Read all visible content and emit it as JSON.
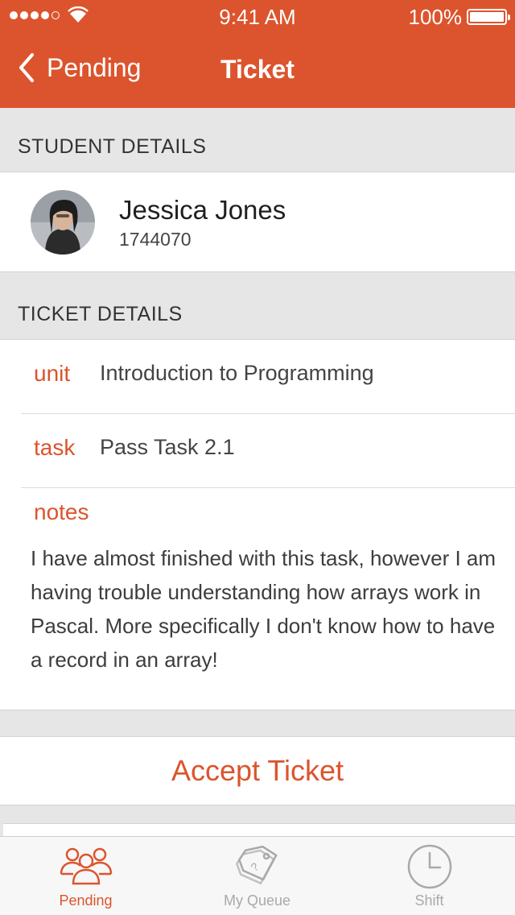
{
  "status_bar": {
    "time": "9:41 AM",
    "battery": "100%"
  },
  "nav": {
    "back_label": "Pending",
    "title": "Ticket"
  },
  "student_details": {
    "header": "STUDENT DETAILS",
    "name": "Jessica Jones",
    "id": "1744070"
  },
  "ticket_details": {
    "header": "TICKET DETAILS",
    "unit_key": "unit",
    "unit_value": "Introduction to Programming",
    "task_key": "task",
    "task_value": "Pass Task 2.1",
    "notes_key": "notes",
    "notes_value": "I have almost finished with this task, however I am having trouble understanding how arrays work in Pascal. More specifically I don't know how to have a record in an array!"
  },
  "actions": {
    "accept_label": "Accept Ticket"
  },
  "tab_bar": {
    "tabs": [
      {
        "label": "Pending",
        "icon": "people-icon",
        "active": true
      },
      {
        "label": "My Queue",
        "icon": "tag-icon",
        "active": false
      },
      {
        "label": "Shift",
        "icon": "clock-icon",
        "active": false
      }
    ]
  },
  "colors": {
    "accent": "#dc542d",
    "background": "#e6e6e6",
    "inactive": "#a9a9a9"
  }
}
